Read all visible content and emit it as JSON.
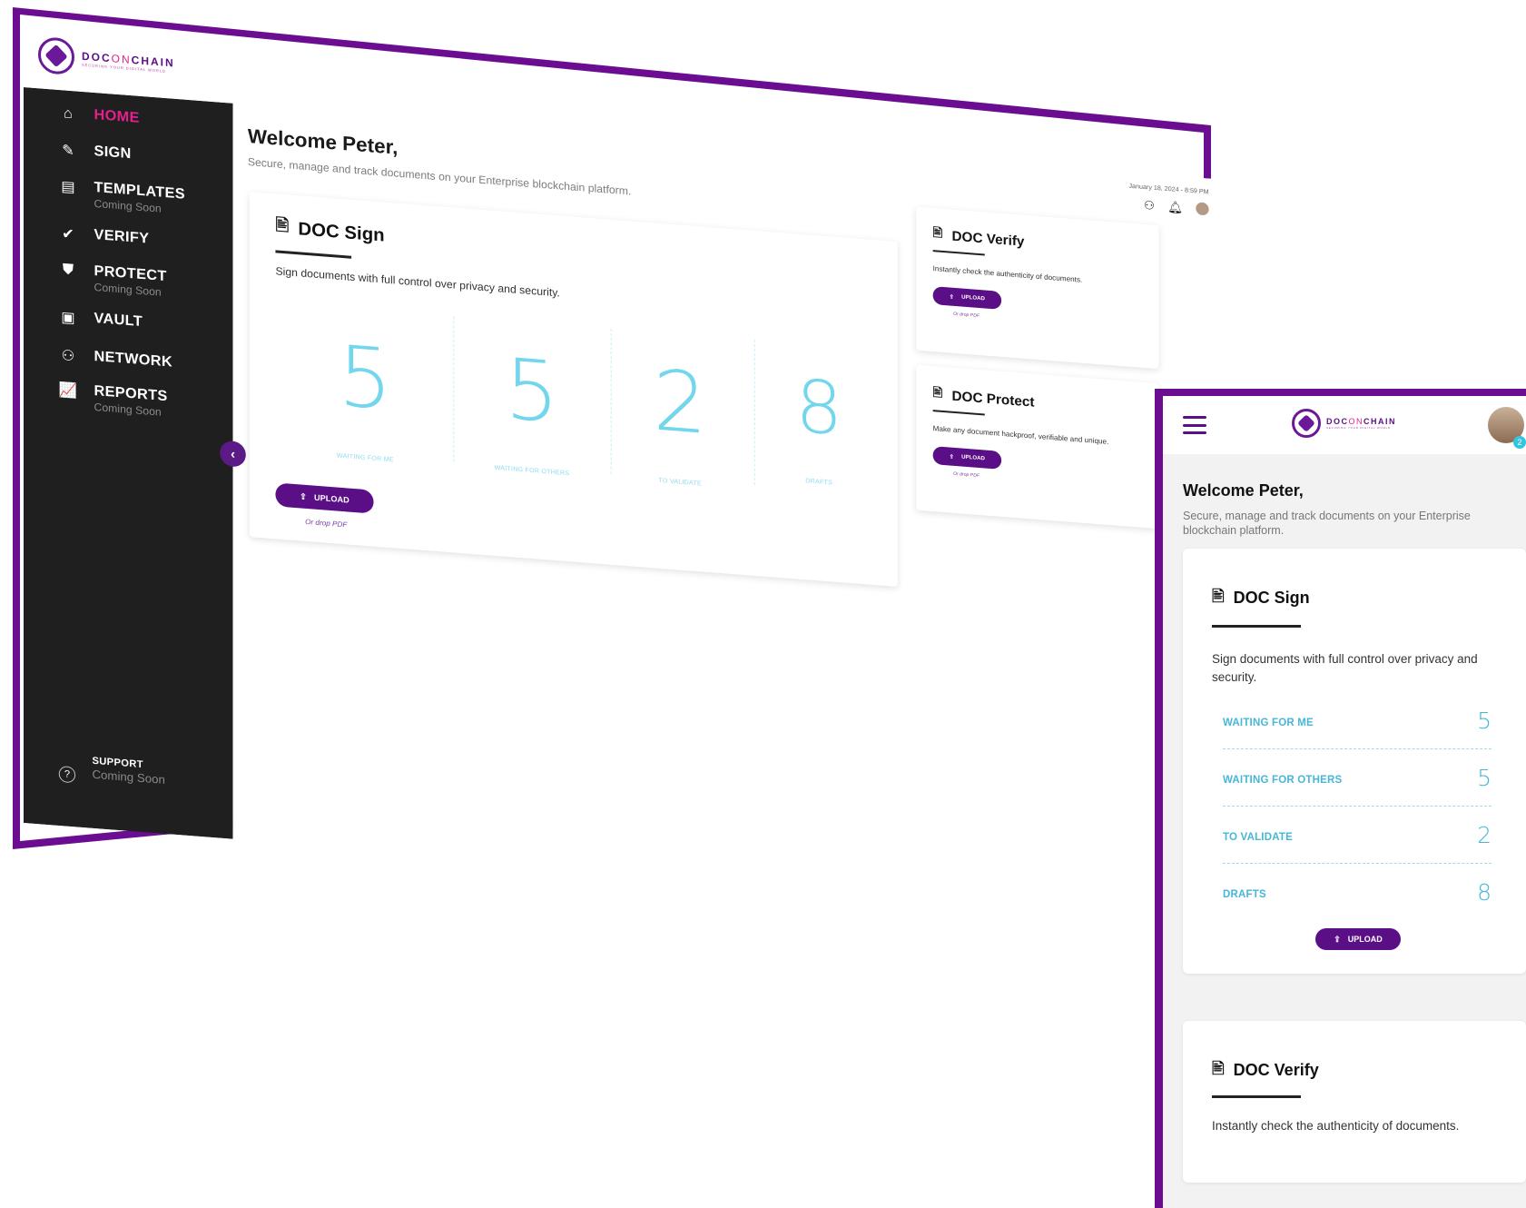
{
  "brand": {
    "name_part1": "DOC",
    "name_part2": "ON",
    "name_part3": "CHAIN",
    "tagline": "SECURING YOUR DIGITAL WORLD",
    "color_primary": "#5b0f86",
    "color_accent": "#e4208c",
    "color_stat": "#72d6ec"
  },
  "sidebar": {
    "items": [
      {
        "label": "HOME",
        "sub": "",
        "icon": "home-icon"
      },
      {
        "label": "SIGN",
        "sub": "",
        "icon": "sign-icon"
      },
      {
        "label": "TEMPLATES",
        "sub": "Coming Soon",
        "icon": "templates-icon"
      },
      {
        "label": "VERIFY",
        "sub": "",
        "icon": "verify-icon"
      },
      {
        "label": "PROTECT",
        "sub": "Coming Soon",
        "icon": "shield-icon"
      },
      {
        "label": "VAULT",
        "sub": "",
        "icon": "vault-icon"
      },
      {
        "label": "NETWORK",
        "sub": "",
        "icon": "network-icon"
      },
      {
        "label": "REPORTS",
        "sub": "Coming Soon",
        "icon": "reports-icon"
      }
    ],
    "support": {
      "label": "SUPPORT",
      "sub": "Coming Soon"
    },
    "collapse_glyph": "‹"
  },
  "header": {
    "welcome": "Welcome Peter,",
    "tagline": "Secure, manage and track documents on your Enterprise blockchain platform.",
    "date": "January 18, 2024 - 8:59 PM"
  },
  "doc_sign": {
    "title": "DOC Sign",
    "desc": "Sign documents with full control over privacy and security.",
    "stats": [
      {
        "value": "5",
        "label": "WAITING FOR ME"
      },
      {
        "value": "5",
        "label": "WAITING FOR OTHERS"
      },
      {
        "value": "2",
        "label": "TO VALIDATE"
      },
      {
        "value": "8",
        "label": "DRAFTS"
      }
    ],
    "upload": "UPLOAD",
    "drop": "Or drop PDF"
  },
  "doc_verify": {
    "title": "DOC Verify",
    "desc": "Instantly check the authenticity of documents.",
    "upload": "UPLOAD",
    "drop": "Or drop PDF"
  },
  "doc_protect": {
    "title": "DOC Protect",
    "desc": "Make any document hackproof, verifiable and unique.",
    "upload": "UPLOAD",
    "drop": "Or drop PDF"
  },
  "mobile": {
    "welcome": "Welcome Peter,",
    "tagline": "Secure, manage and track documents on your Enterprise blockchain platform.",
    "badge": "2",
    "doc_sign": {
      "title": "DOC Sign",
      "desc": "Sign documents with full control over privacy and security.",
      "rows": [
        {
          "label": "WAITING FOR ME",
          "value": "5"
        },
        {
          "label": "WAITING FOR OTHERS",
          "value": "5"
        },
        {
          "label": "TO VALIDATE",
          "value": "2"
        },
        {
          "label": "DRAFTS",
          "value": "8"
        }
      ],
      "upload": "UPLOAD"
    },
    "doc_verify": {
      "title": "DOC Verify",
      "desc": "Instantly check the authenticity of documents."
    }
  }
}
